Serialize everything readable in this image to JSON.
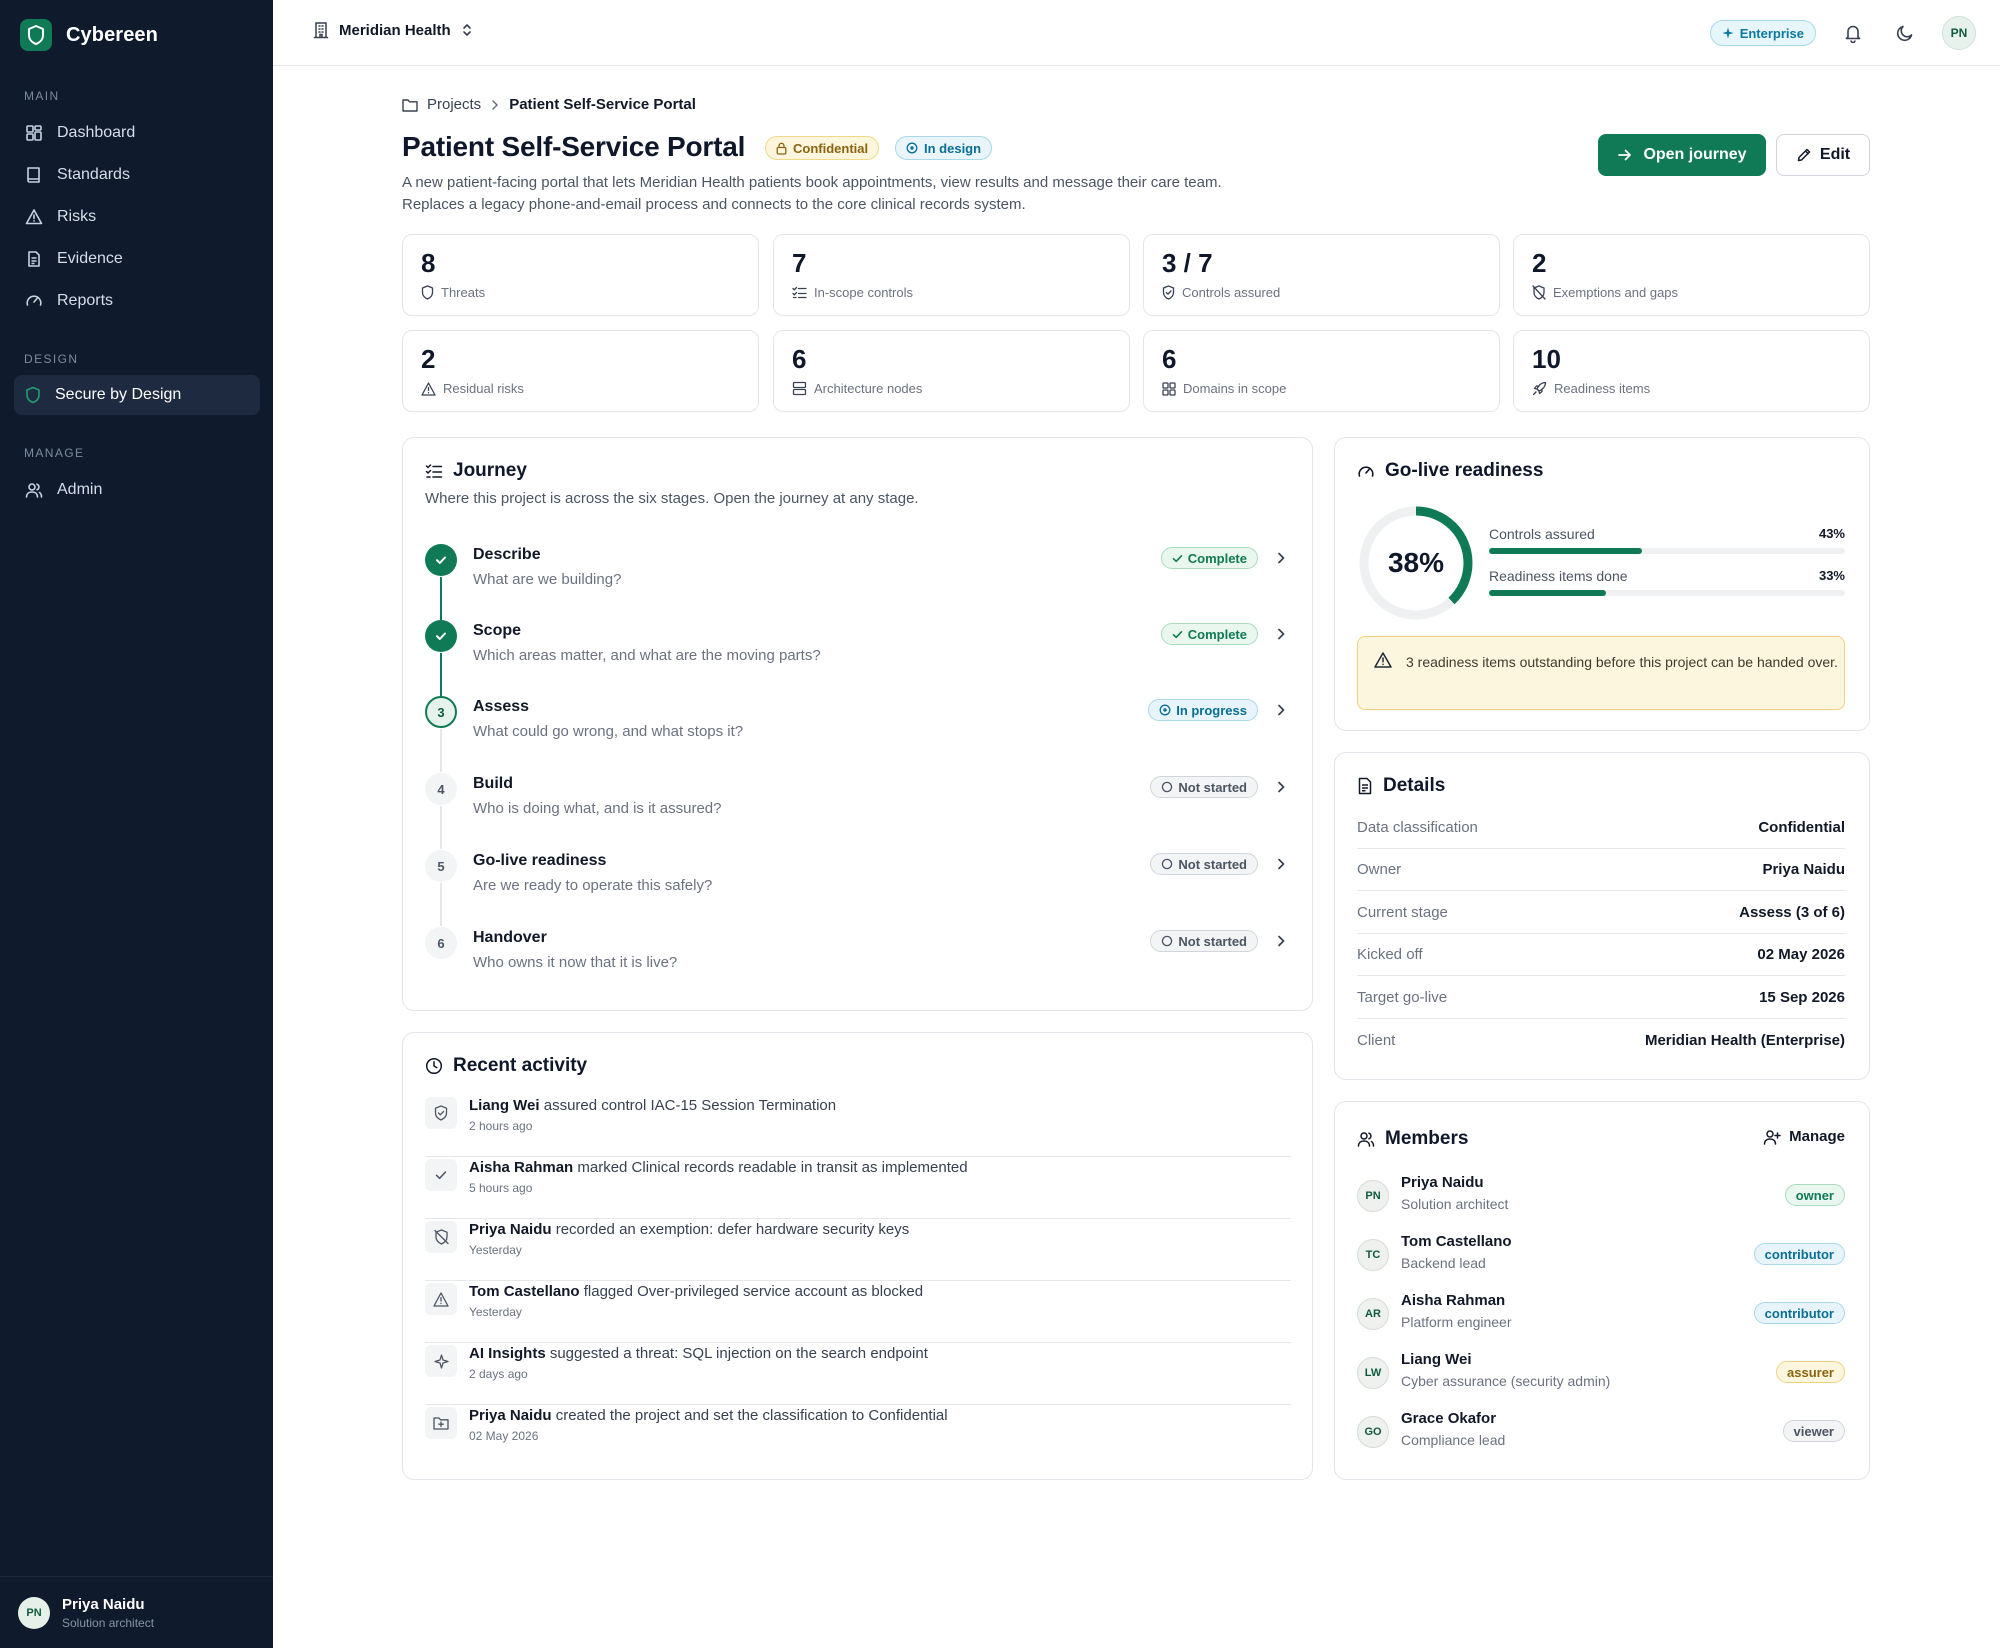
{
  "app": {
    "name": "Cybereen"
  },
  "sidebar": {
    "sections": {
      "main": "MAIN",
      "design": "DESIGN",
      "manage": "MANAGE"
    },
    "items": [
      {
        "label": "Dashboard",
        "icon": "dashboard-icon"
      },
      {
        "label": "Standards",
        "icon": "book-icon"
      },
      {
        "label": "Risks",
        "icon": "warning-icon"
      },
      {
        "label": "Evidence",
        "icon": "file-icon"
      },
      {
        "label": "Reports",
        "icon": "gauge-icon"
      },
      {
        "label": "Secure by Design",
        "icon": "shield-icon",
        "active": true
      },
      {
        "label": "Admin",
        "icon": "users-icon"
      }
    ],
    "user": {
      "initials": "PN",
      "name": "Priya Naidu",
      "role": "Solution architect"
    }
  },
  "topbar": {
    "org": "Meridian Health",
    "plan": "Enterprise",
    "user_initials": "PN"
  },
  "breadcrumb": {
    "root": "Projects",
    "current": "Patient Self-Service Portal"
  },
  "project": {
    "title": "Patient Self-Service Portal",
    "classification_badge": "Confidential",
    "status_badge": "In design",
    "description": "A new patient-facing portal that lets Meridian Health patients book appointments, view results and message their care team. Replaces a legacy phone-and-email process and connects to the core clinical records system.",
    "open_label": "Open journey",
    "edit_label": "Edit"
  },
  "stats": [
    {
      "value": "8",
      "label": "Threats"
    },
    {
      "value": "7",
      "label": "In-scope controls"
    },
    {
      "value": "3 / 7",
      "label": "Controls assured"
    },
    {
      "value": "2",
      "label": "Exemptions and gaps"
    },
    {
      "value": "2",
      "label": "Residual risks"
    },
    {
      "value": "6",
      "label": "Architecture nodes"
    },
    {
      "value": "6",
      "label": "Domains in scope"
    },
    {
      "value": "10",
      "label": "Readiness items"
    }
  ],
  "journey": {
    "title": "Journey",
    "subtitle": "Where this project is across the six stages. Open the journey at any stage.",
    "stages": [
      {
        "num": "1",
        "name": "Describe",
        "question": "What are we building?",
        "status": "Complete"
      },
      {
        "num": "2",
        "name": "Scope",
        "question": "Which areas matter, and what are the moving parts?",
        "status": "Complete"
      },
      {
        "num": "3",
        "name": "Assess",
        "question": "What could go wrong, and what stops it?",
        "status": "In progress"
      },
      {
        "num": "4",
        "name": "Build",
        "question": "Who is doing what, and is it assured?",
        "status": "Not started"
      },
      {
        "num": "5",
        "name": "Go-live readiness",
        "question": "Are we ready to operate this safely?",
        "status": "Not started"
      },
      {
        "num": "6",
        "name": "Handover",
        "question": "Who owns it now that it is live?",
        "status": "Not started"
      }
    ]
  },
  "activity": {
    "title": "Recent activity",
    "items": [
      {
        "actor": "Liang Wei",
        "text": " assured control IAC-15 Session Termination",
        "time": "2 hours ago"
      },
      {
        "actor": "Aisha Rahman",
        "text": " marked Clinical records readable in transit as implemented",
        "time": "5 hours ago"
      },
      {
        "actor": "Priya Naidu",
        "text": " recorded an exemption: defer hardware security keys",
        "time": "Yesterday"
      },
      {
        "actor": "Tom Castellano",
        "text": " flagged Over-privileged service account as blocked",
        "time": "Yesterday"
      },
      {
        "actor": "AI Insights",
        "text": " suggested a threat: SQL injection on the search endpoint",
        "time": "2 days ago"
      },
      {
        "actor": "Priya Naidu",
        "text": " created the project and set the classification to Confidential",
        "time": "02 May 2026"
      }
    ]
  },
  "readiness": {
    "title": "Go-live readiness",
    "overall": "38%",
    "overall_fraction": 0.38,
    "bars": [
      {
        "label": "Controls assured",
        "value": "43%",
        "fraction": 0.43
      },
      {
        "label": "Readiness items done",
        "value": "33%",
        "fraction": 0.33
      }
    ],
    "warning": "3 readiness items outstanding before this project can be handed over."
  },
  "details": {
    "title": "Details",
    "rows": [
      {
        "key": "Data classification",
        "value": "Confidential"
      },
      {
        "key": "Owner",
        "value": "Priya Naidu"
      },
      {
        "key": "Current stage",
        "value": "Assess (3 of 6)"
      },
      {
        "key": "Kicked off",
        "value": "02 May 2026"
      },
      {
        "key": "Target go-live",
        "value": "15 Sep 2026"
      },
      {
        "key": "Client",
        "value": "Meridian Health (Enterprise)"
      }
    ]
  },
  "members": {
    "title": "Members",
    "manage_label": "Manage",
    "items": [
      {
        "initials": "PN",
        "name": "Priya Naidu",
        "role": "Solution architect",
        "access": "owner"
      },
      {
        "initials": "TC",
        "name": "Tom Castellano",
        "role": "Backend lead",
        "access": "contributor"
      },
      {
        "initials": "AR",
        "name": "Aisha Rahman",
        "role": "Platform engineer",
        "access": "contributor"
      },
      {
        "initials": "LW",
        "name": "Liang Wei",
        "role": "Cyber assurance (security admin)",
        "access": "assurer"
      },
      {
        "initials": "GO",
        "name": "Grace Okafor",
        "role": "Compliance lead",
        "access": "viewer"
      }
    ]
  },
  "colors": {
    "brand": "#0f7a55",
    "sidebar": "#0f1b2d"
  }
}
